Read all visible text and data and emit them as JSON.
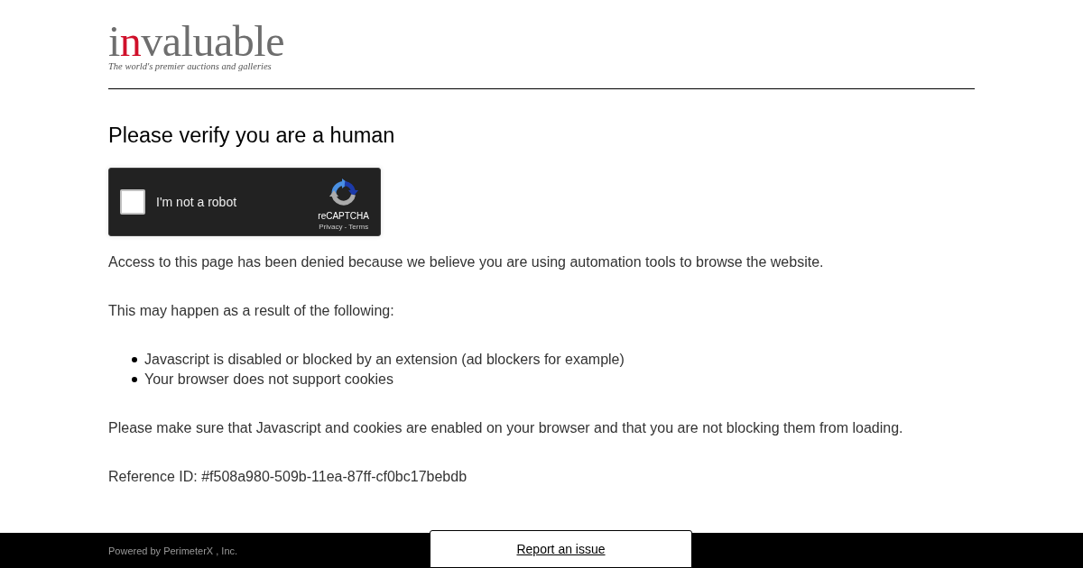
{
  "logo": {
    "lead": "i",
    "accent": "n",
    "rest": "valuable",
    "tagline": "The world's premier auctions and galleries"
  },
  "heading": "Please verify you are a human",
  "captcha": {
    "checked": false,
    "label": "I'm not a robot",
    "brand": "reCAPTCHA",
    "links": "Privacy - Terms"
  },
  "intro": "Access to this page has been denied because we believe you are using automation tools to browse the website.",
  "reasons_intro": "This may happen as a result of the following:",
  "reasons": [
    "Javascript is disabled or blocked by an extension (ad blockers for example)",
    "Your browser does not support cookies"
  ],
  "advice": "Please make sure that Javascript and cookies are enabled on your browser and that you are not blocking them from loading.",
  "reference": "Reference ID: #f508a980-509b-11ea-87ff-cf0bc17bebdb",
  "footer": {
    "powered_by": "Powered by PerimeterX , Inc.",
    "report_button": "Report an issue"
  }
}
